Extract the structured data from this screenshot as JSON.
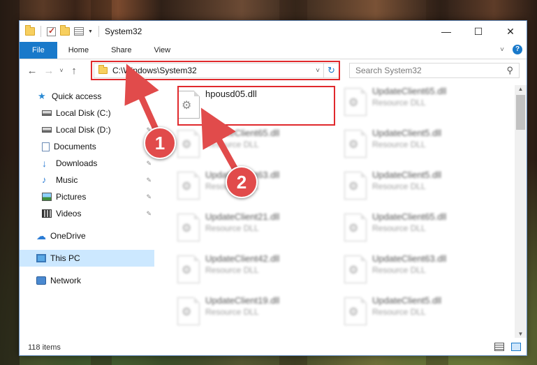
{
  "title_bar": {
    "title": "System32",
    "minimize": "—",
    "maximize": "☐",
    "close": "✕"
  },
  "ribbon": {
    "tabs": [
      "File",
      "Home",
      "Share",
      "View"
    ],
    "help": "?",
    "collapse": "˅"
  },
  "nav": {
    "back": "←",
    "forward": "→",
    "recent": "˅",
    "up": "↑",
    "address": "C:\\Windows\\System32",
    "address_caret": "˅",
    "refresh": "↻",
    "search_placeholder": "Search System32",
    "search_icon": "⚲"
  },
  "sidebar": {
    "items": [
      {
        "label": "Quick access",
        "icon": "star-icon",
        "pinned": false
      },
      {
        "label": "Local Disk (C:)",
        "icon": "drive-icon",
        "pinned": true
      },
      {
        "label": "Local Disk (D:)",
        "icon": "drive-icon",
        "pinned": true
      },
      {
        "label": "Documents",
        "icon": "documents-icon",
        "pinned": true
      },
      {
        "label": "Downloads",
        "icon": "downloads-icon",
        "pinned": true
      },
      {
        "label": "Music",
        "icon": "music-icon",
        "pinned": true
      },
      {
        "label": "Pictures",
        "icon": "pictures-icon",
        "pinned": true
      },
      {
        "label": "Videos",
        "icon": "videos-icon",
        "pinned": true
      },
      {
        "label": "OneDrive",
        "icon": "onedrive-icon",
        "pinned": false
      },
      {
        "label": "This PC",
        "icon": "this-pc-icon",
        "pinned": false
      },
      {
        "label": "Network",
        "icon": "network-icon",
        "pinned": false
      }
    ],
    "pin_glyph": "📌"
  },
  "files": {
    "highlighted": {
      "name": "hpousd05.dll"
    },
    "left_column": [
      {
        "name": "UpdateClient65.dll",
        "type": "Resource DLL"
      },
      {
        "name": "UpdateClient63.dll",
        "type": "Resource DLL"
      },
      {
        "name": "UpdateClient21.dll",
        "type": "Resource DLL"
      },
      {
        "name": "UpdateClient42.dll",
        "type": "Resource DLL"
      },
      {
        "name": "UpdateClient19.dll",
        "type": "Resource DLL"
      }
    ],
    "right_column": [
      {
        "name": "UpdateClient65.dll",
        "type": "Resource DLL"
      },
      {
        "name": "UpdateClient5.dll",
        "type": "Resource DLL"
      },
      {
        "name": "UpdateClient5.dll",
        "type": "Resource DLL"
      },
      {
        "name": "UpdateClient65.dll",
        "type": "Resource DLL"
      },
      {
        "name": "UpdateClient63.dll",
        "type": "Resource DLL"
      },
      {
        "name": "UpdateClient5.dll",
        "type": "Resource DLL"
      }
    ]
  },
  "status": {
    "item_count": "118 items"
  },
  "callouts": {
    "step1": "1",
    "step2": "2",
    "color": "#e0292c"
  }
}
